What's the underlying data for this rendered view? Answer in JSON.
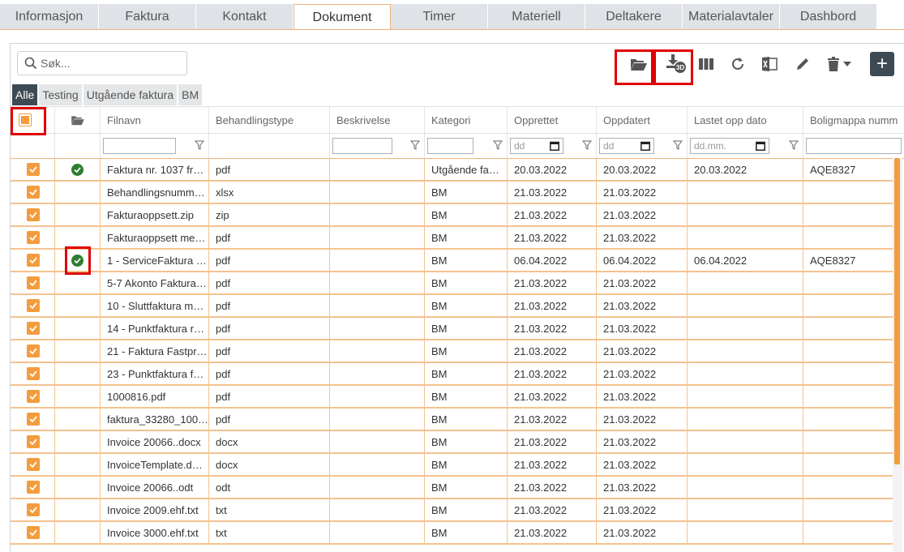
{
  "tabs": [
    {
      "label": "Informasjon",
      "active": false
    },
    {
      "label": "Faktura",
      "active": false
    },
    {
      "label": "Kontakt",
      "active": false
    },
    {
      "label": "Dokument",
      "active": true
    },
    {
      "label": "Timer",
      "active": false
    },
    {
      "label": "Materiell",
      "active": false
    },
    {
      "label": "Deltakere",
      "active": false
    },
    {
      "label": "Materialavtaler",
      "active": false
    },
    {
      "label": "Dashbord",
      "active": false
    }
  ],
  "search": {
    "placeholder": "Søk..."
  },
  "toolbar": {
    "icons": [
      "folder-open-icon",
      "download-3d-icon",
      "columns-icon",
      "refresh-icon",
      "excel-icon",
      "pencil-icon",
      "trash-icon",
      "caret-down-icon"
    ],
    "add_label": "+"
  },
  "filter_tabs": [
    {
      "label": "Alle",
      "active": true
    },
    {
      "label": "Testing",
      "active": false
    },
    {
      "label": "Utgående faktura",
      "active": false
    },
    {
      "label": "BM",
      "active": false
    }
  ],
  "columns": [
    "Filnavn",
    "Behandlingstype",
    "Beskrivelse",
    "Kategori",
    "Opprettet",
    "Oppdatert",
    "Lastet opp dato",
    "Boligmappa numm"
  ],
  "filters": {
    "date_placeholder": "dd",
    "date_placeholder_long": "dd.mm."
  },
  "badge_3d": "3D",
  "colors": {
    "accent": "#f39c3d",
    "header_dark": "#3d4a54",
    "ok_green": "#2e7d32",
    "highlight": "#e00000"
  },
  "rows": [
    {
      "ok": true,
      "filnavn": "Faktura nr. 1037 fr…",
      "type": "pdf",
      "beskrivelse": "",
      "kategori": "Utgående fa…",
      "opprettet": "20.03.2022",
      "oppdatert": "20.03.2022",
      "lastet": "20.03.2022",
      "bolig": "AQE8327"
    },
    {
      "ok": false,
      "filnavn": "Behandlingsnumm…",
      "type": "xlsx",
      "beskrivelse": "",
      "kategori": "BM",
      "opprettet": "21.03.2022",
      "oppdatert": "21.03.2022",
      "lastet": "",
      "bolig": ""
    },
    {
      "ok": false,
      "filnavn": "Fakturaoppsett.zip",
      "type": "zip",
      "beskrivelse": "",
      "kategori": "BM",
      "opprettet": "21.03.2022",
      "oppdatert": "21.03.2022",
      "lastet": "",
      "bolig": ""
    },
    {
      "ok": false,
      "filnavn": "Fakturaoppsett me…",
      "type": "pdf",
      "beskrivelse": "",
      "kategori": "BM",
      "opprettet": "21.03.2022",
      "oppdatert": "21.03.2022",
      "lastet": "",
      "bolig": ""
    },
    {
      "ok": true,
      "filnavn": "1 - ServiceFaktura …",
      "type": "pdf",
      "beskrivelse": "",
      "kategori": "BM",
      "opprettet": "06.04.2022",
      "oppdatert": "06.04.2022",
      "lastet": "06.04.2022",
      "bolig": "AQE8327"
    },
    {
      "ok": false,
      "filnavn": "5-7 Akonto Faktura…",
      "type": "pdf",
      "beskrivelse": "",
      "kategori": "BM",
      "opprettet": "21.03.2022",
      "oppdatert": "21.03.2022",
      "lastet": "",
      "bolig": ""
    },
    {
      "ok": false,
      "filnavn": "10 - Sluttfaktura m…",
      "type": "pdf",
      "beskrivelse": "",
      "kategori": "BM",
      "opprettet": "21.03.2022",
      "oppdatert": "21.03.2022",
      "lastet": "",
      "bolig": ""
    },
    {
      "ok": false,
      "filnavn": "14 - Punktfaktura r…",
      "type": "pdf",
      "beskrivelse": "",
      "kategori": "BM",
      "opprettet": "21.03.2022",
      "oppdatert": "21.03.2022",
      "lastet": "",
      "bolig": ""
    },
    {
      "ok": false,
      "filnavn": "21 - Faktura Fastpr…",
      "type": "pdf",
      "beskrivelse": "",
      "kategori": "BM",
      "opprettet": "21.03.2022",
      "oppdatert": "21.03.2022",
      "lastet": "",
      "bolig": ""
    },
    {
      "ok": false,
      "filnavn": "23 - Punktfaktura f…",
      "type": "pdf",
      "beskrivelse": "",
      "kategori": "BM",
      "opprettet": "21.03.2022",
      "oppdatert": "21.03.2022",
      "lastet": "",
      "bolig": ""
    },
    {
      "ok": false,
      "filnavn": "1000816.pdf",
      "type": "pdf",
      "beskrivelse": "",
      "kategori": "BM",
      "opprettet": "21.03.2022",
      "oppdatert": "21.03.2022",
      "lastet": "",
      "bolig": ""
    },
    {
      "ok": false,
      "filnavn": "faktura_33280_100…",
      "type": "pdf",
      "beskrivelse": "",
      "kategori": "BM",
      "opprettet": "21.03.2022",
      "oppdatert": "21.03.2022",
      "lastet": "",
      "bolig": ""
    },
    {
      "ok": false,
      "filnavn": "Invoice 20066..docx",
      "type": "docx",
      "beskrivelse": "",
      "kategori": "BM",
      "opprettet": "21.03.2022",
      "oppdatert": "21.03.2022",
      "lastet": "",
      "bolig": ""
    },
    {
      "ok": false,
      "filnavn": "InvoiceTemplate.d…",
      "type": "docx",
      "beskrivelse": "",
      "kategori": "BM",
      "opprettet": "21.03.2022",
      "oppdatert": "21.03.2022",
      "lastet": "",
      "bolig": ""
    },
    {
      "ok": false,
      "filnavn": "Invoice 20066..odt",
      "type": "odt",
      "beskrivelse": "",
      "kategori": "BM",
      "opprettet": "21.03.2022",
      "oppdatert": "21.03.2022",
      "lastet": "",
      "bolig": ""
    },
    {
      "ok": false,
      "filnavn": "Invoice 2009.ehf.txt",
      "type": "txt",
      "beskrivelse": "",
      "kategori": "BM",
      "opprettet": "21.03.2022",
      "oppdatert": "21.03.2022",
      "lastet": "",
      "bolig": ""
    },
    {
      "ok": false,
      "filnavn": "Invoice 3000.ehf.txt",
      "type": "txt",
      "beskrivelse": "",
      "kategori": "BM",
      "opprettet": "21.03.2022",
      "oppdatert": "21.03.2022",
      "lastet": "",
      "bolig": ""
    }
  ]
}
